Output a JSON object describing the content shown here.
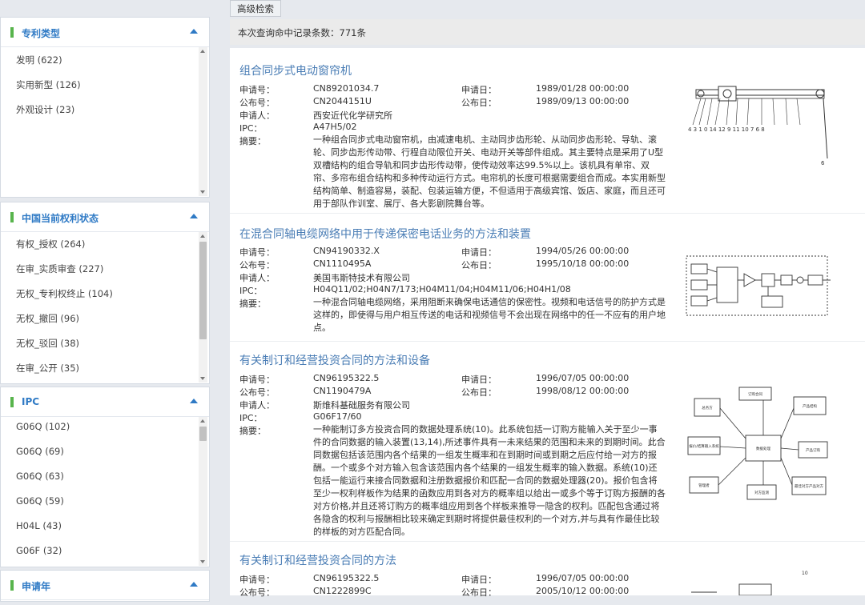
{
  "sidebar": {
    "panels": [
      {
        "title": "专利类型",
        "items": [
          "发明 (622)",
          "实用新型 (126)",
          "外观设计 (23)"
        ]
      },
      {
        "title": "中国当前权利状态",
        "items": [
          "有权_授权 (264)",
          "在审_实质审查 (227)",
          "无权_专利权终止 (104)",
          "无权_撤回 (96)",
          "无权_驳回 (38)",
          "在审_公开 (35)"
        ]
      },
      {
        "title": "IPC",
        "items": [
          "G06Q (102)",
          "G06Q (69)",
          "G06Q (63)",
          "G06Q (59)",
          "H04L (43)",
          "G06F (32)"
        ]
      },
      {
        "title": "申请年",
        "items": []
      }
    ]
  },
  "toolbar": {
    "advanced_search": "高级检索"
  },
  "summary": {
    "count_text": "本次查询命中记录条数：771条"
  },
  "labels": {
    "app_no": "申请号：",
    "pub_no": "公布号：",
    "applicant": "申请人：",
    "ipc": "IPC：",
    "abstract": "摘要：",
    "app_date": "申请日：",
    "pub_date": "公布日："
  },
  "records": [
    {
      "title": "组合同步式电动窗帘机",
      "app_no": "CN89201034.7",
      "pub_no": "CN2044151U",
      "applicant": "西安近代化学研究所",
      "ipc": "A47H5/02",
      "app_date": "1989/01/28 00:00:00",
      "pub_date": "1989/09/13 00:00:00",
      "abstract": "一种组合同步式电动窗帘机，由减速电机、主动同步齿形轮、从动同步齿形轮、导轨、滚轮、同步齿形传动带、行程自动限位开关、电动开关等部件组成。其主要特点是采用了U型双槽结构的组合导轨和同步齿形传动带，使传动效率达99.5%以上。该机具有单帘、双帘、多帘布组合结构和多种传动运行方式。电帘机的长度可根据需要组合而成。本实用新型结构简单、制造容易，装配、包装运输方便，不但适用于高级宾馆、饭店、家庭，而且还可用于部队作训室、展厅、各大影剧院舞台等。"
    },
    {
      "title": "在混合同轴电缆网络中用于传递保密电话业务的方法和装置",
      "app_no": "CN94190332.X",
      "pub_no": "CN1110495A",
      "applicant": "美国韦斯特技术有限公司",
      "ipc": "H04Q11/02;H04N7/173;H04M11/04;H04M11/06;H04H1/08",
      "app_date": "1994/05/26 00:00:00",
      "pub_date": "1995/10/18 00:00:00",
      "abstract": "一种混合同轴电缆网络，采用阻断来确保电话通信的保密性。视频和电话信号的防护方式是这样的，即使得与用户相互传送的电话和视频信号不会出现在网络中的任一不应有的用户地点。"
    },
    {
      "title": "有关制订和经营投资合同的方法和设备",
      "app_no": "CN96195322.5",
      "pub_no": "CN1190479A",
      "applicant": "斯维科基础服务有限公司",
      "ipc": "G06F17/60",
      "app_date": "1996/07/05 00:00:00",
      "pub_date": "1998/08/12 00:00:00",
      "abstract": "一种能制订多方投资合同的数据处理系统(10)。此系统包括一订购方能输入关于至少一事件的合同数据的输入装置(13,14),所述事件具有一未来结果的范围和未来的到期时间。此合同数据包括该范围内各个结果的一组发生概率和在到期时间或到期之后应付给一对方的报酬。一个或多个对方输入包含该范围内各个结果的一组发生概率的输入数据。系统(10)还包括一能运行来接合同数据和注册数据报价和匹配一合同的数据处理器(20)。报价包含将至少一权利样板作为结果的函数应用到各对方的概率组以给出一或多个等于订购方报酬的各对方价格,并且还将订购方的概率组应用到各个样板来推导一隐含的权利。匹配包含通过将各隐含的权利与报酬相比较来确定到期时将提供最佳权利的一个对方,并与具有作最佳比较的样板的对方匹配合同。"
    },
    {
      "title": "有关制订和经营投资合同的方法",
      "app_no": "CN96195322.5",
      "pub_no": "CN1222899C",
      "app_date": "1996/07/05 00:00:00",
      "pub_date": "2005/10/12 00:00:00"
    }
  ],
  "drawings": {
    "rec1_labels": "4 3 1 0 14 12 9 11 10 7 6 8",
    "rec3_boxes": [
      "总务方",
      "订购合同",
      "报价/结算输入系统",
      "数据处理",
      "产品结构",
      "产品订购",
      "管理者",
      "对方监测",
      "最佳对方产品对方"
    ]
  }
}
